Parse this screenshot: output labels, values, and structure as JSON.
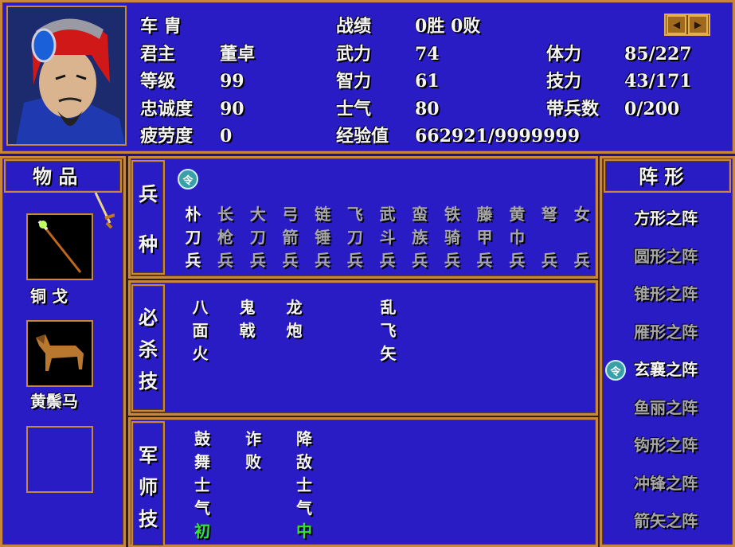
{
  "general": {
    "name": "车  胄",
    "lord_label": "君主",
    "lord_value": "董卓",
    "level_label": "等级",
    "level_value": "99",
    "loyalty_label": "忠诚度",
    "loyalty_value": "90",
    "fatigue_label": "疲劳度",
    "fatigue_value": "0",
    "record_label": "战绩",
    "record_value": "0胜  0败",
    "strength_label": "武力",
    "strength_value": "74",
    "intel_label": "智力",
    "intel_value": "61",
    "morale_label": "士气",
    "morale_value": "80",
    "exp_label": "经验值",
    "exp_value": "662921/9999999",
    "hp_label": "体力",
    "hp_value": "85/227",
    "mp_label": "技力",
    "mp_value": "43/171",
    "troops_label": "带兵数",
    "troops_value": "0/200"
  },
  "nav": {
    "prev_icon": "arrow-left-icon",
    "next_icon": "arrow-right-icon"
  },
  "items": {
    "title": "物 品",
    "slot1_label": "铜  戈",
    "slot2_label": "黄鬃马",
    "slot3_label": ""
  },
  "troops": {
    "title_chars": [
      "兵",
      "种"
    ],
    "marker": "令",
    "types": [
      [
        "朴",
        "刀",
        "兵"
      ],
      [
        "长",
        "枪",
        "兵"
      ],
      [
        "大",
        "刀",
        "兵"
      ],
      [
        "弓",
        "箭",
        "兵"
      ],
      [
        "链",
        "锤",
        "兵"
      ],
      [
        "飞",
        "刀",
        "兵"
      ],
      [
        "武",
        "斗",
        "兵"
      ],
      [
        "蛮",
        "族",
        "兵"
      ],
      [
        "铁",
        "骑",
        "兵"
      ],
      [
        "藤",
        "甲",
        "兵"
      ],
      [
        "黄",
        "巾",
        "兵"
      ],
      [
        "弩",
        "",
        "兵"
      ],
      [
        "女",
        "",
        "兵"
      ]
    ]
  },
  "special": {
    "title_chars": [
      "必",
      "杀",
      "技"
    ],
    "skills": [
      [
        "八",
        "面",
        "火"
      ],
      [
        "鬼",
        "戟",
        ""
      ],
      [
        "龙",
        "炮",
        ""
      ],
      [
        "",
        "",
        ""
      ],
      [
        "乱",
        "飞",
        "矢"
      ]
    ]
  },
  "strategy": {
    "title_chars": [
      "军",
      "师",
      "技"
    ],
    "skills": [
      [
        "鼓",
        "舞",
        "士",
        "气",
        "初"
      ],
      [
        "诈",
        "败",
        "",
        "",
        ""
      ],
      [
        "降",
        "敌",
        "士",
        "气",
        "中"
      ]
    ]
  },
  "formations": {
    "title": "阵 形",
    "marker": "令",
    "list": [
      "方形之阵",
      "圆形之阵",
      "锥形之阵",
      "雁形之阵",
      "玄襄之阵",
      "鱼丽之阵",
      "钩形之阵",
      "冲锋之阵",
      "箭矢之阵"
    ],
    "active_index": 4
  }
}
